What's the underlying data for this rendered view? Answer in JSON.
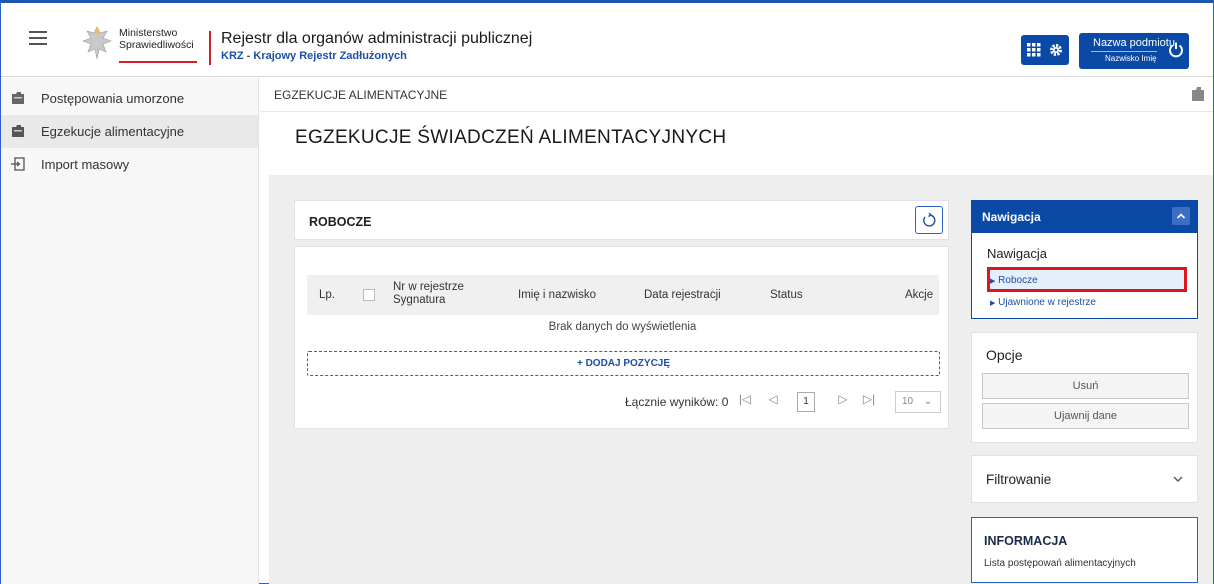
{
  "header": {
    "logo_line1": "Ministerstwo",
    "logo_line2": "Sprawiedliwości",
    "title": "Rejestr dla organów administracji publicznej",
    "subtitle": "KRZ - Krajowy Rejestr Zadłużonych",
    "user_name": "Nazwa podmiotu",
    "user_sub": "Nazwisko Imię",
    "accent_color": "#0a4aa6"
  },
  "sidebar": {
    "items": [
      {
        "label": "Postępowania umorzone",
        "icon": "folder-icon"
      },
      {
        "label": "Egzekucje alimentacyjne",
        "icon": "folder-icon",
        "active": true
      },
      {
        "label": "Import masowy",
        "icon": "import-icon"
      }
    ]
  },
  "breadcrumb": "EGZEKUCJE ALIMENTACYJNE",
  "page_title": "EGZEKUCJE ŚWIADCZEŃ ALIMENTACYJNYCH",
  "panel": {
    "title": "ROBOCZE",
    "columns": [
      "Lp.",
      "Nr w rejestrze",
      "Sygnatura",
      "Imię i nazwisko",
      "Data rejestracji",
      "Status",
      "Akcje"
    ],
    "empty_text": "Brak danych do wyświetlenia",
    "add_label": "+ DODAJ POZYCJĘ",
    "total_label": "Łącznie wyników: 0",
    "current_page": "1",
    "page_size": "10"
  },
  "navigation": {
    "header": "Nawigacja",
    "subtitle": "Nawigacja",
    "links": [
      "Robocze",
      "Ujawnione w rejestrze"
    ]
  },
  "options": {
    "title": "Opcje",
    "buttons": [
      "Usuń",
      "Ujawnij dane"
    ]
  },
  "filter": {
    "title": "Filtrowanie"
  },
  "info": {
    "title": "INFORMACJA",
    "text": "Lista postępowań alimentacyjnych"
  }
}
